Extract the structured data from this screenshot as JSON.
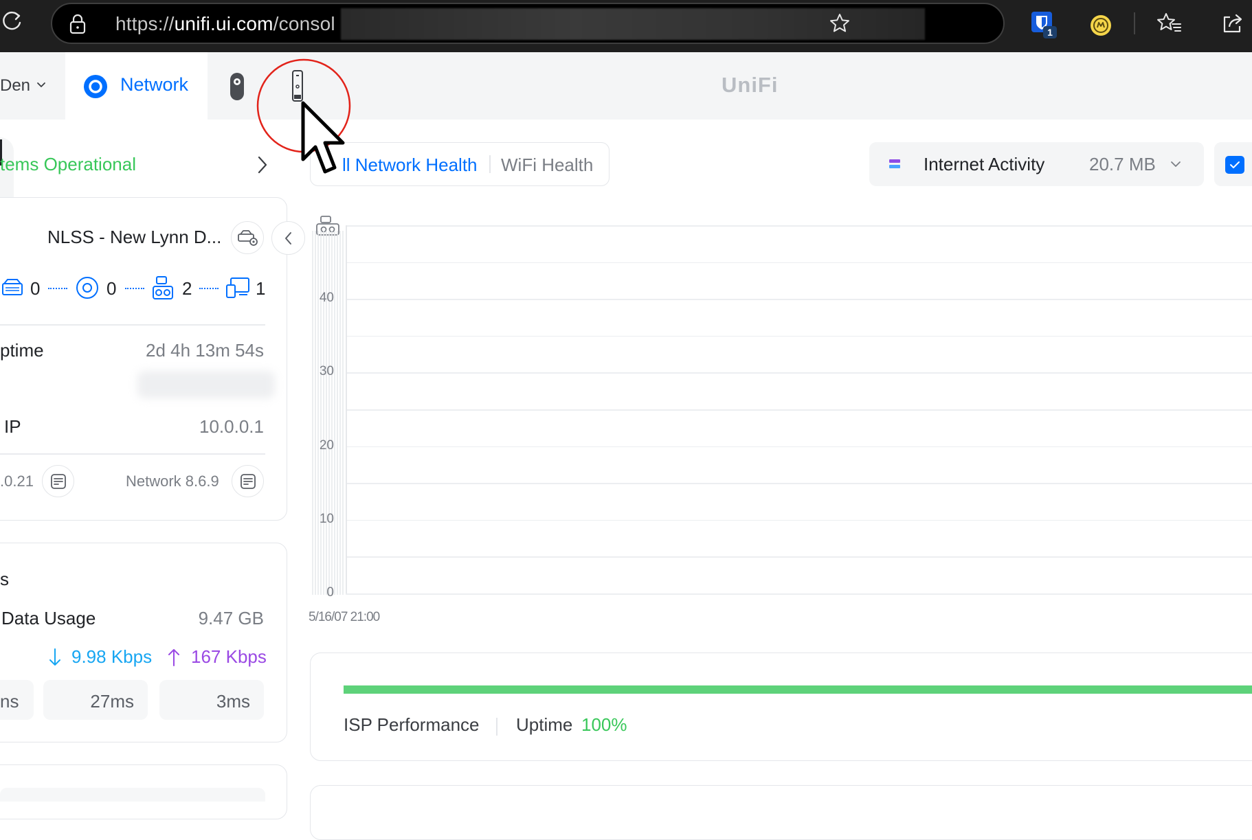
{
  "browser": {
    "url_scheme": "https://",
    "url_host": "unifi.ui.com",
    "url_path": "/consol",
    "extension_badge": "1"
  },
  "header": {
    "site_selector": "Den",
    "network_tab": "Network",
    "brand": "UniFi"
  },
  "status": {
    "label": "tems Operational"
  },
  "filters": {
    "tabs": [
      "ll Network Health",
      "WiFi Health"
    ],
    "activity_label": "Internet Activity",
    "activity_value": "20.7 MB"
  },
  "gateway_card": {
    "name": "NLSS - New Lynn D...",
    "counts": [
      "0",
      "0",
      "2",
      "1"
    ],
    "uptime_label": "ptime",
    "uptime_value": "2d 4h 13m 54s",
    "ip_label": "IP",
    "ip_value": "10.0.0.1",
    "firmware_version": ".0.21",
    "network_version": "Network 8.6.9"
  },
  "wan_card": {
    "title_fragment": "s",
    "data_usage_label": "Data Usage",
    "data_usage_value": "9.47 GB",
    "download": "9.98 Kbps",
    "upload": "167 Kbps",
    "latencies": [
      "ns",
      "27ms",
      "3ms"
    ]
  },
  "chart_data": {
    "type": "line",
    "title": "",
    "xlabel": "",
    "ylabel": "",
    "ylim": [
      0,
      50
    ],
    "yticks": [
      "40",
      "30",
      "20",
      "10",
      "0"
    ],
    "x_tick_text": "5/16/07 21:00",
    "series": []
  },
  "isp": {
    "label": "ISP Performance",
    "uptime_label": "Uptime",
    "uptime_value": "100%"
  },
  "colors": {
    "accent": "#006fff",
    "success": "#38c759",
    "isp_bar": "#5ed27a",
    "download": "#17a6f2",
    "upload": "#9a49e4",
    "cursor_ring": "#e2231a"
  }
}
